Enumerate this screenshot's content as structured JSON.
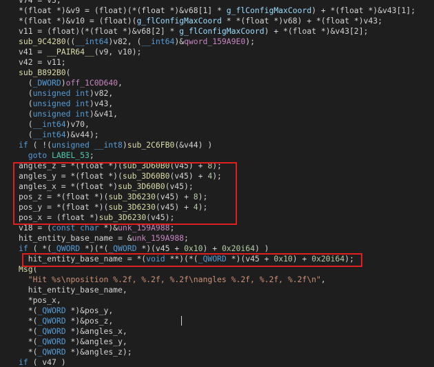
{
  "editor": {
    "lines": [
      [
        [
          "t-var",
          "v74 = v3;"
        ]
      ],
      [
        [
          "t-plain",
          "*(float *)&v9 = (float)(*(float *)&v68[1] * "
        ],
        [
          "t-glob",
          "g_flConfigMaxCoord"
        ],
        [
          "t-plain",
          ") + *(float *)&v43[1];"
        ]
      ],
      [
        [
          "t-plain",
          "*(float *)&v10 = (float)("
        ],
        [
          "t-glob",
          "g_flConfigMaxCoord"
        ],
        [
          "t-plain",
          " * *(float *)v68) + *(float *)v43;"
        ]
      ],
      [
        [
          "t-plain",
          "v11 = (float)(*(float *)&v68[2] * "
        ],
        [
          "t-glob",
          "g_flConfigMaxCoord"
        ],
        [
          "t-plain",
          ") + *(float *)&v43[2];"
        ]
      ],
      [
        [
          "t-fn",
          "sub_9C4280"
        ],
        [
          "t-plain",
          "(("
        ],
        [
          "t-kw",
          "__int64"
        ],
        [
          "t-plain",
          ")v82, ("
        ],
        [
          "t-kw",
          "__int64"
        ],
        [
          "t-plain",
          ")&"
        ],
        [
          "t-data",
          "qword_159A9E0"
        ],
        [
          "t-plain",
          ");"
        ]
      ],
      [
        [
          "t-plain",
          "v41 = "
        ],
        [
          "t-fn",
          "__PAIR64__"
        ],
        [
          "t-plain",
          "(v9, v10);"
        ]
      ],
      [
        [
          "t-plain",
          "v42 = v11;"
        ]
      ],
      [
        [
          "t-fn",
          "sub_B892B0"
        ],
        [
          "t-plain",
          "("
        ]
      ],
      [
        [
          "t-plain",
          "  ("
        ],
        [
          "t-kw",
          "_DWORD"
        ],
        [
          "t-plain",
          ")"
        ],
        [
          "t-data",
          "off_1C0D640"
        ],
        [
          "t-plain",
          ","
        ]
      ],
      [
        [
          "t-plain",
          "  ("
        ],
        [
          "t-kw",
          "unsigned int"
        ],
        [
          "t-plain",
          ")v82,"
        ]
      ],
      [
        [
          "t-plain",
          "  ("
        ],
        [
          "t-kw",
          "unsigned int"
        ],
        [
          "t-plain",
          ")v43,"
        ]
      ],
      [
        [
          "t-plain",
          "  ("
        ],
        [
          "t-kw",
          "unsigned int"
        ],
        [
          "t-plain",
          ")&v41,"
        ]
      ],
      [
        [
          "t-plain",
          "  ("
        ],
        [
          "t-kw",
          "__int64"
        ],
        [
          "t-plain",
          ")v70,"
        ]
      ],
      [
        [
          "t-plain",
          "  ("
        ],
        [
          "t-kw",
          "__int64"
        ],
        [
          "t-plain",
          ")&v44);"
        ]
      ],
      [
        [
          "t-kw",
          "if"
        ],
        [
          "t-plain",
          " ( !("
        ],
        [
          "t-kw",
          "unsigned __int8"
        ],
        [
          "t-plain",
          ")"
        ],
        [
          "t-fn",
          "sub_2C6FB0"
        ],
        [
          "t-plain",
          "(&v44) )"
        ]
      ],
      [
        [
          "t-plain",
          "  "
        ],
        [
          "t-kw",
          "goto"
        ],
        [
          "t-plain",
          " "
        ],
        [
          "t-lbl",
          "LABEL_53"
        ],
        [
          "t-plain",
          ";"
        ]
      ],
      [
        [
          "t-plain",
          "angles_z = *(float *)("
        ],
        [
          "t-fn",
          "sub_3D60B0"
        ],
        [
          "t-plain",
          "(v45) + "
        ],
        [
          "t-num",
          "8"
        ],
        [
          "t-plain",
          ");"
        ]
      ],
      [
        [
          "t-plain",
          "angles_y = *(float *)("
        ],
        [
          "t-fn",
          "sub_3D60B0"
        ],
        [
          "t-plain",
          "(v45) + "
        ],
        [
          "t-num",
          "4"
        ],
        [
          "t-plain",
          ");"
        ]
      ],
      [
        [
          "t-plain",
          "angles_x = *(float *)"
        ],
        [
          "t-fn",
          "sub_3D60B0"
        ],
        [
          "t-plain",
          "(v45);"
        ]
      ],
      [
        [
          "t-plain",
          "pos_z = *(float *)("
        ],
        [
          "t-fn",
          "sub_3D6230"
        ],
        [
          "t-plain",
          "(v45) + "
        ],
        [
          "t-num",
          "8"
        ],
        [
          "t-plain",
          ");"
        ]
      ],
      [
        [
          "t-plain",
          "pos_y = *(float *)("
        ],
        [
          "t-fn",
          "sub_3D6230"
        ],
        [
          "t-plain",
          "(v45) + "
        ],
        [
          "t-num",
          "4"
        ],
        [
          "t-plain",
          ");"
        ]
      ],
      [
        [
          "t-plain",
          "pos_x = (float *)"
        ],
        [
          "t-fn",
          "sub_3D6230"
        ],
        [
          "t-plain",
          "(v45);"
        ]
      ],
      [
        [
          "t-plain",
          "v18 = ("
        ],
        [
          "t-kw",
          "const char"
        ],
        [
          "t-plain",
          " *)&"
        ],
        [
          "t-data",
          "unk_159A988"
        ],
        [
          "t-plain",
          ";"
        ]
      ],
      [
        [
          "t-plain",
          "hit_entity_base_name = &"
        ],
        [
          "t-data",
          "unk_159A988"
        ],
        [
          "t-plain",
          ";"
        ]
      ],
      [
        [
          "t-kw",
          "if"
        ],
        [
          "t-plain",
          " ( *("
        ],
        [
          "t-kw",
          "_QWORD"
        ],
        [
          "t-plain",
          " *)(*("
        ],
        [
          "t-kw",
          "_QWORD"
        ],
        [
          "t-plain",
          " *)(v45 + "
        ],
        [
          "t-num",
          "0x10"
        ],
        [
          "t-plain",
          ") + "
        ],
        [
          "t-num",
          "0x20i64"
        ],
        [
          "t-plain",
          ") )"
        ]
      ],
      [
        [
          "t-plain",
          "  hit_entity_base_name = *("
        ],
        [
          "t-kw",
          "void"
        ],
        [
          "t-plain",
          " **)(*("
        ],
        [
          "t-kw",
          "_QWORD"
        ],
        [
          "t-plain",
          " *)(v45 + "
        ],
        [
          "t-num",
          "0x10"
        ],
        [
          "t-plain",
          ") + "
        ],
        [
          "t-num",
          "0x20i64"
        ],
        [
          "t-plain",
          ");"
        ]
      ],
      [
        [
          "t-fn",
          "Msg"
        ],
        [
          "t-plain",
          "("
        ]
      ],
      [
        [
          "t-plain",
          "  "
        ],
        [
          "t-str",
          "\"Hit %s\\nposition %.2f, %.2f, %.2f\\nangles %.2f, %.2f, %.2f\\n\""
        ],
        [
          "t-plain",
          ","
        ]
      ],
      [
        [
          "t-plain",
          "  hit_entity_base_name,"
        ]
      ],
      [
        [
          "t-plain",
          "  *pos_x,"
        ]
      ],
      [
        [
          "t-plain",
          "  *("
        ],
        [
          "t-kw",
          "_QWORD"
        ],
        [
          "t-plain",
          " *)&pos_y,"
        ]
      ],
      [
        [
          "t-plain",
          "  *("
        ],
        [
          "t-kw",
          "_QWORD"
        ],
        [
          "t-plain",
          " *)&pos_z,"
        ]
      ],
      [
        [
          "t-plain",
          "  *("
        ],
        [
          "t-kw",
          "_QWORD"
        ],
        [
          "t-plain",
          " *)&angles_x,"
        ]
      ],
      [
        [
          "t-plain",
          "  *("
        ],
        [
          "t-kw",
          "_QWORD"
        ],
        [
          "t-plain",
          " *)&angles_y,"
        ]
      ],
      [
        [
          "t-plain",
          "  *("
        ],
        [
          "t-kw",
          "_QWORD"
        ],
        [
          "t-plain",
          " *)&angles_z);"
        ]
      ],
      [
        [
          "t-kw",
          "if"
        ],
        [
          "t-plain",
          " ( v47 )"
        ]
      ]
    ]
  }
}
